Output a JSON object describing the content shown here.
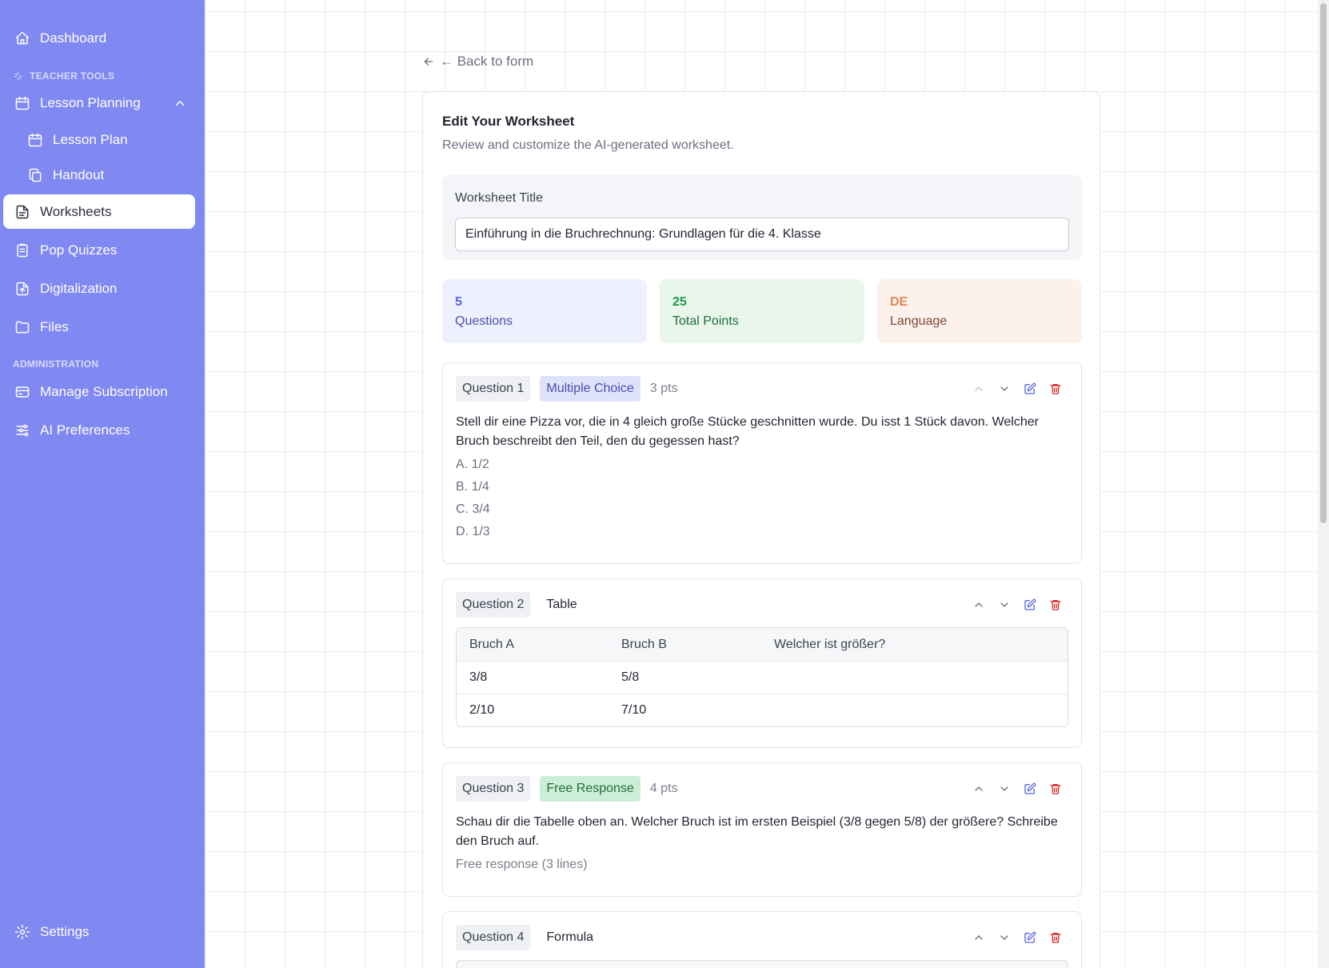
{
  "sidebar": {
    "dashboard": "Dashboard",
    "teacher_tools_label": "TEACHER TOOLS",
    "lesson_planning": "Lesson Planning",
    "lesson_plan": "Lesson Plan",
    "handout": "Handout",
    "worksheets": "Worksheets",
    "pop_quizzes": "Pop Quizzes",
    "digitalization": "Digitalization",
    "files": "Files",
    "administration_label": "ADMINISTRATION",
    "manage_subscription": "Manage Subscription",
    "ai_preferences": "AI Preferences",
    "settings": "Settings"
  },
  "back_link": "← Back to form",
  "editor": {
    "title": "Edit Your Worksheet",
    "subtitle": "Review and customize the AI-generated worksheet.",
    "worksheet_title_label": "Worksheet Title",
    "worksheet_title_value": "Einführung in die Bruchrechnung: Grundlagen für die 4. Klasse"
  },
  "stats": {
    "questions": {
      "value": "5",
      "label": "Questions"
    },
    "points": {
      "value": "25",
      "label": "Total Points"
    },
    "language": {
      "value": "DE",
      "label": "Language"
    }
  },
  "questions": [
    {
      "number": "Question 1",
      "type": "Multiple Choice",
      "points": "3 pts",
      "text": "Stell dir eine Pizza vor, die in 4 gleich große Stücke geschnitten wurde. Du isst 1 Stück davon. Welcher Bruch beschreibt den Teil, den du gegessen hast?",
      "options": [
        "A. 1/2",
        "B. 1/4",
        "C. 3/4",
        "D. 1/3"
      ]
    },
    {
      "number": "Question 2",
      "type": "Table",
      "headers": [
        "Bruch A",
        "Bruch B",
        "Welcher ist größer?"
      ],
      "rows": [
        [
          "3/8",
          "5/8",
          ""
        ],
        [
          "2/10",
          "7/10",
          ""
        ]
      ]
    },
    {
      "number": "Question 3",
      "type": "Free Response",
      "points": "4 pts",
      "text": "Schau dir die Tabelle oben an. Welcher Bruch ist im ersten Beispiel (3/8 gegen 5/8) der größere? Schreibe den Bruch auf.",
      "hint": "Free response (3 lines)"
    },
    {
      "number": "Question 4",
      "type": "Formula"
    }
  ],
  "colors": {
    "sidebar_bg": "#8088f2",
    "accent": "#5b63e6",
    "delete": "#dc2626"
  }
}
